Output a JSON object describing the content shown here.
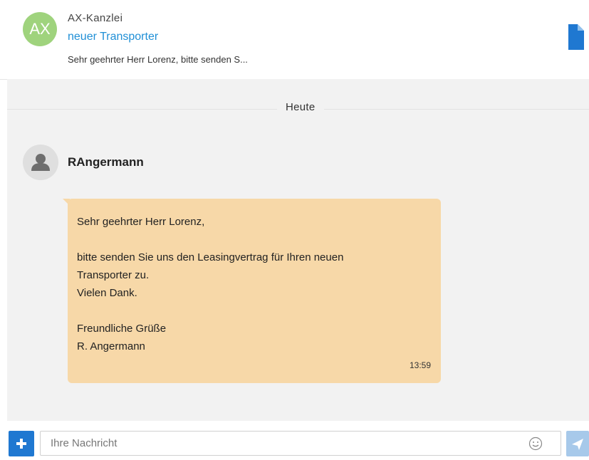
{
  "header": {
    "avatar_initials": "AX",
    "sender": "AX-Kanzlei",
    "subject": "neuer Transporter",
    "preview": "Sehr geehrter Herr Lorenz, bitte senden S..."
  },
  "chat": {
    "day_label": "Heute",
    "sender_name": "RAngermann",
    "message": {
      "lines": [
        "Sehr geehrter Herr Lorenz,",
        "",
        "bitte senden Sie uns den Leasingvertrag für Ihren neuen",
        "Transporter zu.",
        "Vielen Dank.",
        "",
        "Freundliche Grüße",
        "R. Angermann"
      ],
      "time": "13:59"
    }
  },
  "composer": {
    "placeholder": "Ihre Nachricht"
  },
  "colors": {
    "accent": "#1f78d1",
    "link": "#1f8fd6",
    "bubble": "#f7d8a8",
    "avatar_ax": "#9fd37d"
  },
  "icons": {
    "document": "document-icon",
    "plus": "plus-icon",
    "smiley": "smiley-icon",
    "send": "send-icon",
    "user": "user-icon"
  }
}
